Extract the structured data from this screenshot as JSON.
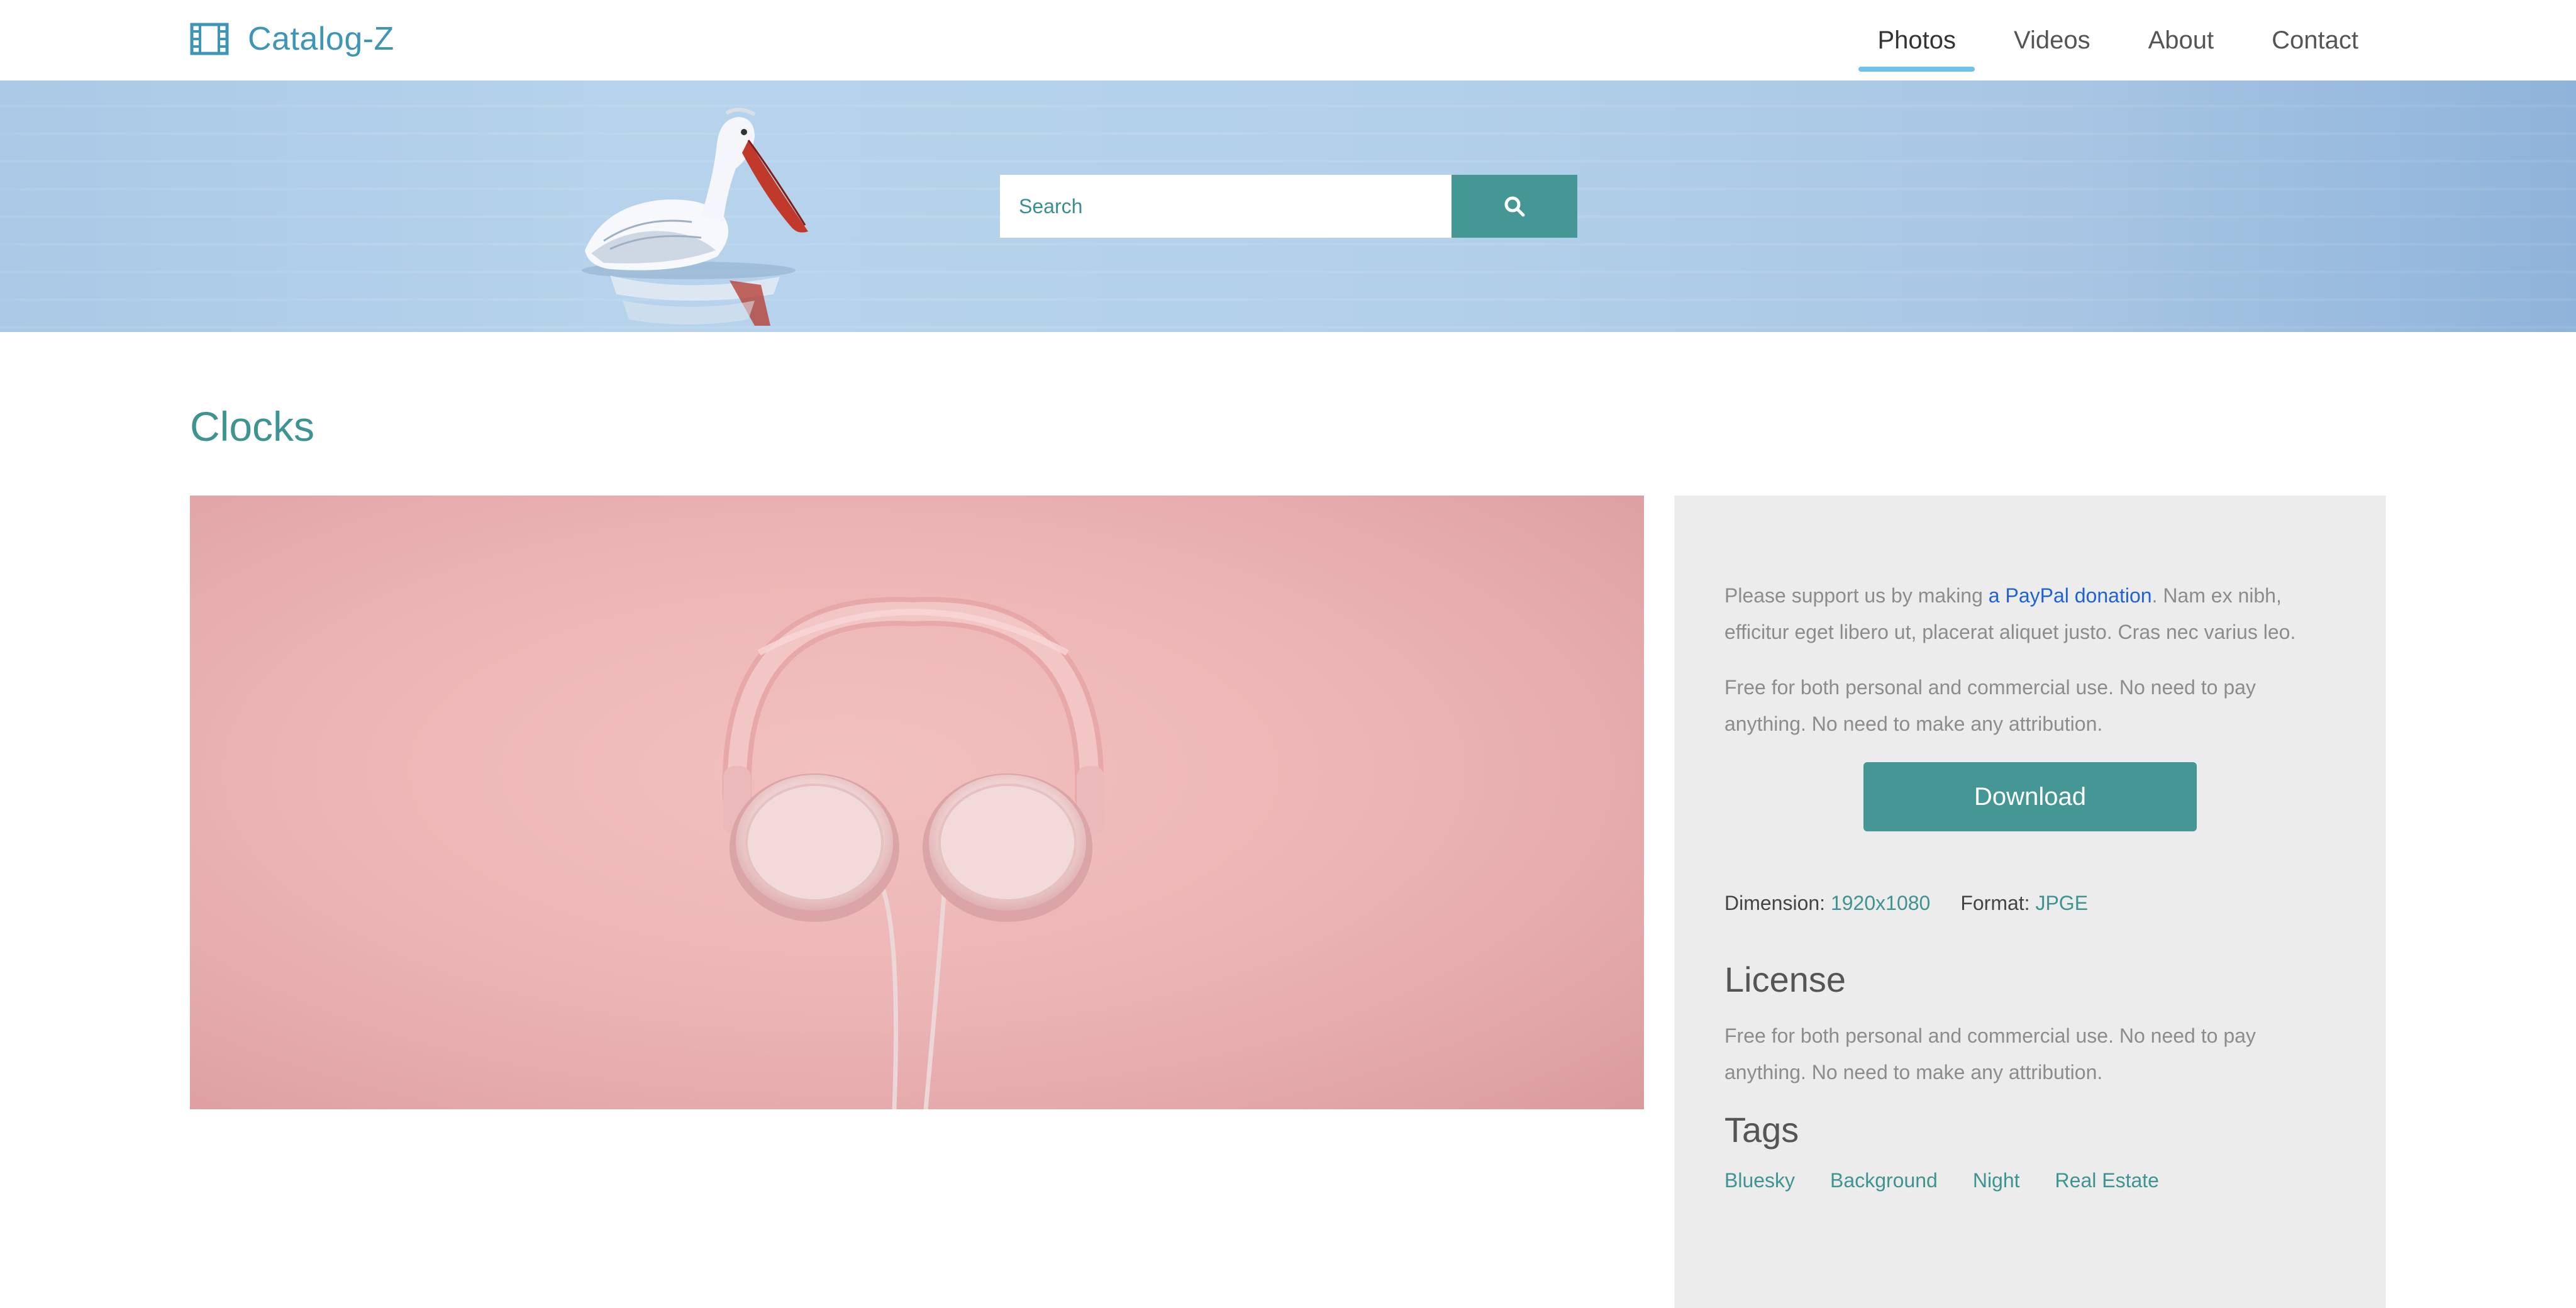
{
  "header": {
    "brand": "Catalog-Z",
    "brand_icon": "film-icon",
    "nav": [
      {
        "label": "Photos",
        "active": true
      },
      {
        "label": "Videos",
        "active": false
      },
      {
        "label": "About",
        "active": false
      },
      {
        "label": "Contact",
        "active": false
      }
    ]
  },
  "hero": {
    "search_placeholder": "Search",
    "search_icon": "search-icon"
  },
  "page": {
    "title": "Clocks"
  },
  "details": {
    "support_before": "Please support us by making ",
    "support_link": "a PayPal donation",
    "support_after": ". Nam ex nibh, efficitur eget libero ut, placerat aliquet justo. Cras nec varius leo.",
    "usage_text": "Free for both personal and commercial use. No need to pay anything. No need to make any attribution.",
    "download_label": "Download",
    "dimension_label": "Dimension:",
    "dimension_value": "1920x1080",
    "format_label": "Format:",
    "format_value": "JPGE",
    "license_heading": "License",
    "license_text": "Free for both personal and commercial use. No need to pay anything. No need to make any attribution.",
    "tags_heading": "Tags",
    "tags": [
      "Bluesky",
      "Background",
      "Night",
      "Real Estate"
    ]
  },
  "colors": {
    "accent": "#449795",
    "brand": "#3d95b7",
    "nav_indicator": "#6fc2e8",
    "link": "#1f62d6",
    "sidebar_bg": "#ececec"
  }
}
